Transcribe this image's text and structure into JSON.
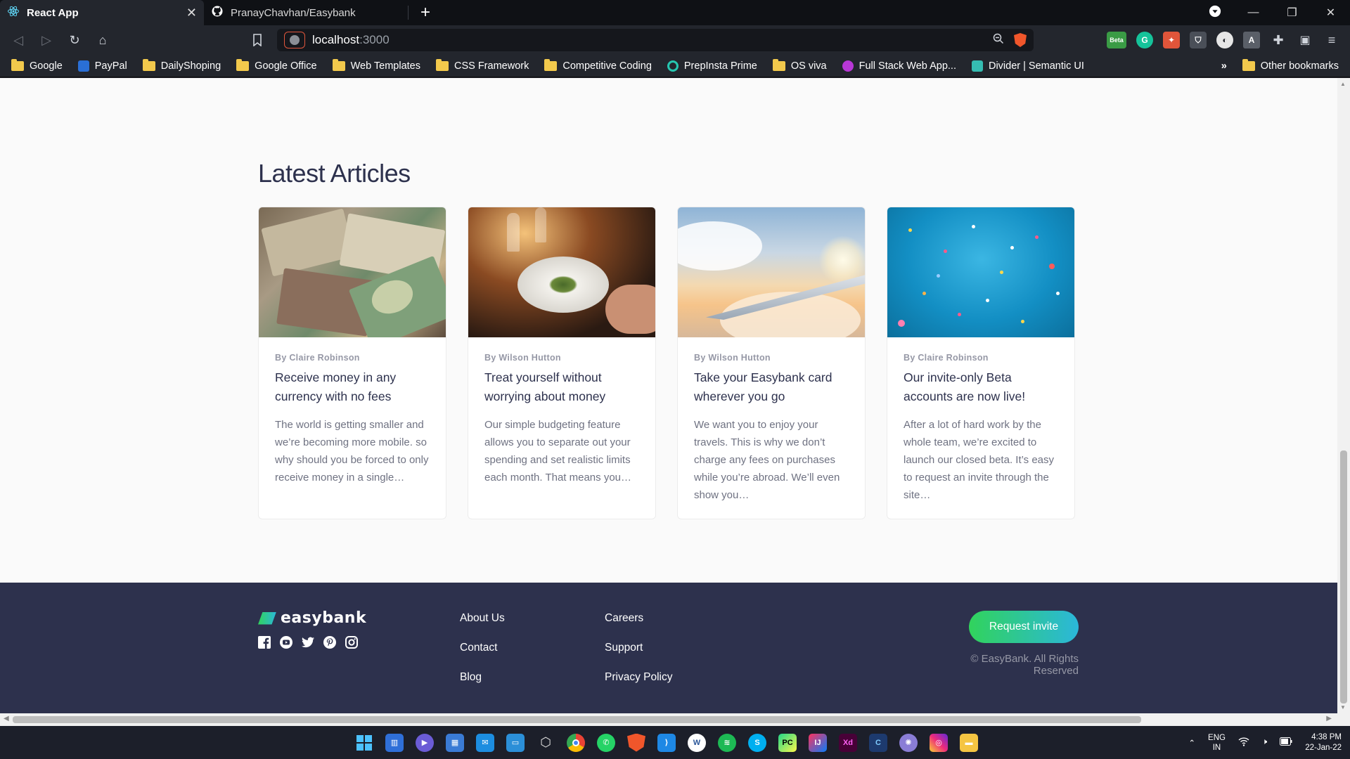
{
  "browser": {
    "tabs": [
      {
        "title": "React App",
        "active": true
      },
      {
        "title": "PranayChavhan/Easybank",
        "active": false
      }
    ],
    "url": {
      "host": "localhost",
      "port": ":3000"
    },
    "bookmarks": [
      {
        "label": "Google",
        "icon": "folder-icon"
      },
      {
        "label": "PayPal",
        "icon": "paypal-icon"
      },
      {
        "label": "DailyShoping",
        "icon": "folder-icon"
      },
      {
        "label": "Google Office",
        "icon": "folder-icon"
      },
      {
        "label": "Web Templates",
        "icon": "folder-icon"
      },
      {
        "label": "CSS Framework",
        "icon": "folder-icon"
      },
      {
        "label": "Competitive Coding",
        "icon": "folder-icon"
      },
      {
        "label": "PrepInsta Prime",
        "icon": "prepinsta-icon"
      },
      {
        "label": "OS viva",
        "icon": "folder-icon"
      },
      {
        "label": "Full Stack Web App...",
        "icon": "fullstack-icon"
      },
      {
        "label": "Divider | Semantic UI",
        "icon": "semantic-ui-icon"
      }
    ],
    "more_bookmarks": "»",
    "other_bookmarks": "Other bookmarks",
    "ext_beta_label": "Beta"
  },
  "articles": {
    "heading": "Latest Articles",
    "cards": [
      {
        "author": "By Claire Robinson",
        "title": "Receive money in any currency with no fees",
        "excerpt": "The world is getting smaller and we’re becoming more mobile. so why should you be forced to only receive money in a single…",
        "image": "currency-notes"
      },
      {
        "author": "By Wilson Hutton",
        "title": "Treat yourself without worrying about money",
        "excerpt": "Our simple budgeting feature allows you to separate out your spending and set realistic limits each month. That means you…",
        "image": "restaurant-plate"
      },
      {
        "author": "By Wilson Hutton",
        "title": "Take your Easybank card wherever you go",
        "excerpt": "We want you to enjoy your travels. This is why we don’t charge any fees on purchases while you’re abroad. We’ll even show you…",
        "image": "airplane-wing"
      },
      {
        "author": "By Claire Robinson",
        "title": "Our invite-only Beta accounts are now live!",
        "excerpt": "After a lot of hard work by the whole team, we’re excited to launch our closed beta. It’s easy to request an invite through the site…",
        "image": "confetti"
      }
    ]
  },
  "footer": {
    "logo": "easybank",
    "socials": [
      "facebook-icon",
      "youtube-icon",
      "twitter-icon",
      "pinterest-icon",
      "instagram-icon"
    ],
    "links_col1": [
      "About Us",
      "Contact",
      "Blog"
    ],
    "links_col2": [
      "Careers",
      "Support",
      "Privacy Policy"
    ],
    "cta": "Request invite",
    "copyright": "© EasyBank. All Rights Reserved"
  },
  "taskbar": {
    "apps": [
      "start",
      "widgets",
      "teams-chat",
      "store",
      "mail",
      "remote-desktop",
      "3d-viewer",
      "chrome",
      "whatsapp",
      "brave",
      "vscode",
      "word",
      "spotify",
      "skype",
      "pycharm",
      "intellij",
      "xd",
      "codeblocks",
      "app-launcher",
      "instagram",
      "file-explorer"
    ],
    "lang_top": "ENG",
    "lang_bottom": "IN",
    "time": "4:38 PM",
    "date": "22-Jan-22"
  },
  "colors": {
    "navy": "#2d314d",
    "green": "#31d35c",
    "cyan": "#2bb7da",
    "grey_text": "#9698a6"
  }
}
